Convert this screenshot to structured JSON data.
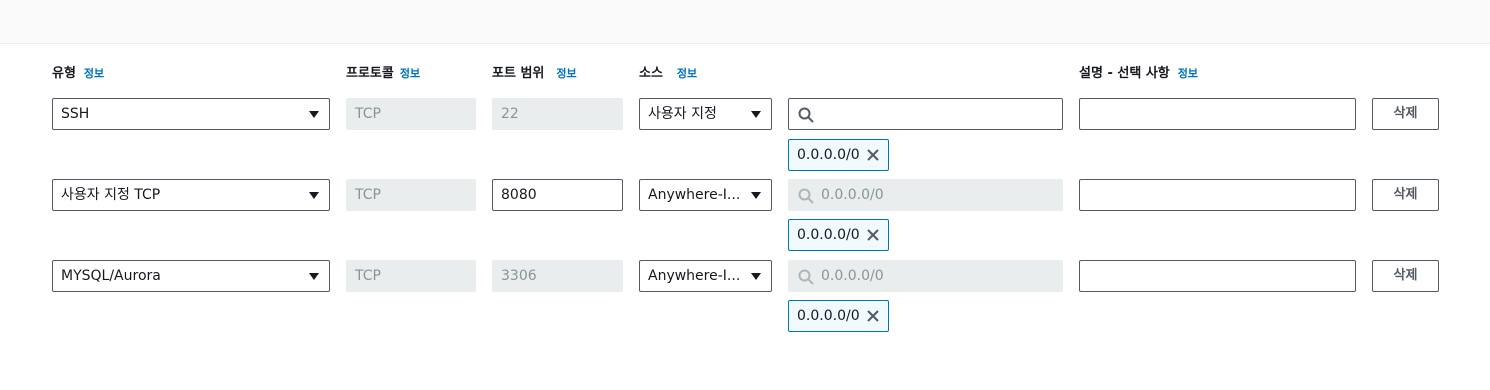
{
  "headers": {
    "type": "유형",
    "protocol": "프로토콜",
    "port_range": "포트 범위",
    "source": "소스",
    "description": "설명 - 선택 사항",
    "info": "정보"
  },
  "rules": [
    {
      "type": "SSH",
      "protocol": "TCP",
      "port": "22",
      "port_editable": false,
      "source": "사용자 지정",
      "cidr_search_value": "",
      "cidr_search_placeholder": "",
      "cidr_search_disabled": false,
      "cidr_token": "0.0.0.0/0",
      "description": "",
      "delete_label": "삭제"
    },
    {
      "type": "사용자 지정 TCP",
      "protocol": "TCP",
      "port": "8080",
      "port_editable": true,
      "source": "Anywhere-I...",
      "cidr_search_placeholder": "0.0.0.0/0",
      "cidr_search_disabled": true,
      "cidr_token": "0.0.0.0/0",
      "description": "",
      "delete_label": "삭제"
    },
    {
      "type": "MYSQL/Aurora",
      "protocol": "TCP",
      "port": "3306",
      "port_editable": false,
      "source": "Anywhere-I...",
      "cidr_search_placeholder": "0.0.0.0/0",
      "cidr_search_disabled": true,
      "cidr_token": "0.0.0.0/0",
      "description": "",
      "delete_label": "삭제"
    }
  ]
}
